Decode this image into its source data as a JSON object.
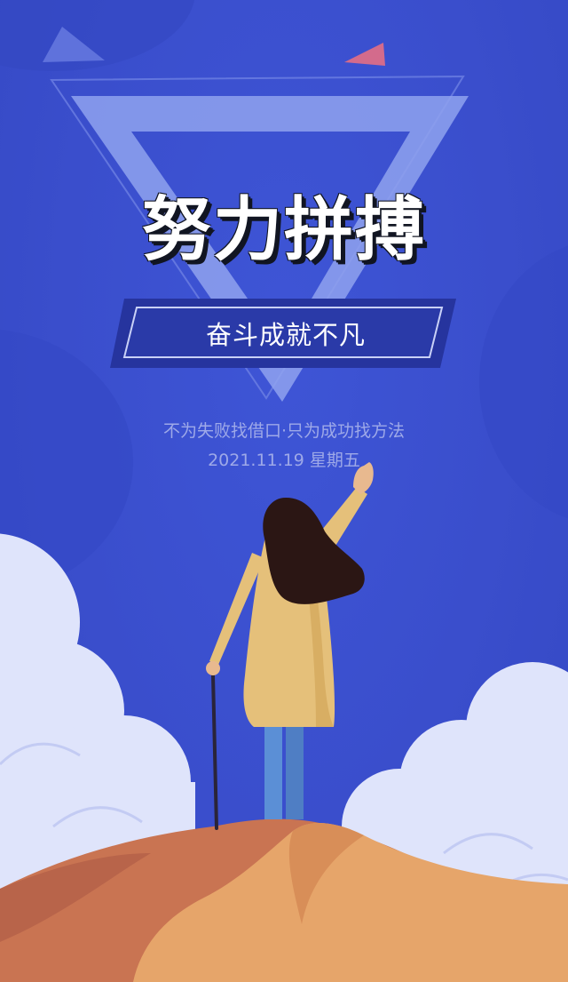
{
  "poster": {
    "headline": "努力拼搏",
    "banner": "奋斗成就不凡",
    "slogan": "不为失败找借口·只为成功找方法",
    "date": "2021.11.19  星期五"
  },
  "colors": {
    "background": "#3b4fd0",
    "triangle": "#8fa2ee",
    "banner_fill": "#2a3aa8",
    "cloud": "#dfe4fb",
    "coat": "#e5c07a",
    "hair": "#2b1614",
    "jeans": "#5b8fd6",
    "mountain_front": "#e6a56a",
    "mountain_back": "#c97452",
    "accent_triangle": "#d36b8c"
  }
}
